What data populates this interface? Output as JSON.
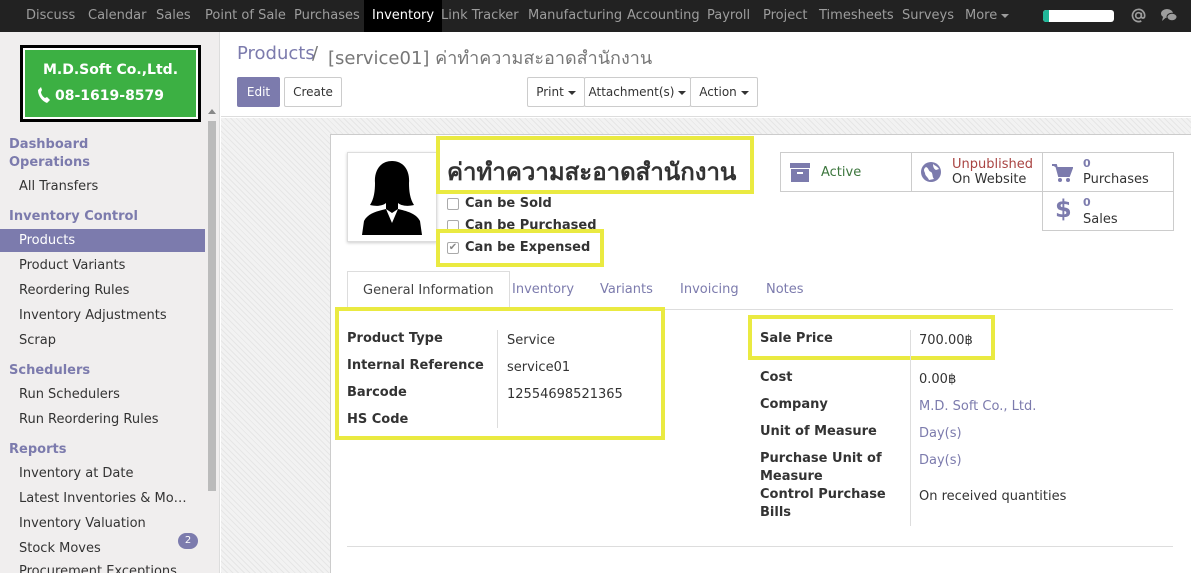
{
  "topbar": {
    "items": [
      "Discuss",
      "Calendar",
      "Sales",
      "Point of Sale",
      "Purchases",
      "Inventory",
      "Link Tracker",
      "Manufacturing",
      "Accounting",
      "Payroll",
      "Project",
      "Timesheets",
      "Surveys",
      "More"
    ],
    "active": "Inventory",
    "progress_fraction": 0.08
  },
  "logo": {
    "name": "M.D.Soft Co.,Ltd.",
    "phone": "08-1619-8579"
  },
  "sidebar": {
    "dashboard": "Dashboard",
    "operations": "Operations",
    "all_transfers": "All Transfers",
    "inventory_control": "Inventory Control",
    "products": "Products",
    "product_variants": "Product Variants",
    "reordering_rules": "Reordering Rules",
    "inventory_adjustments": "Inventory Adjustments",
    "scrap": "Scrap",
    "schedulers": "Schedulers",
    "run_schedulers": "Run Schedulers",
    "run_reordering_rules": "Run Reordering Rules",
    "reports": "Reports",
    "inventory_at_date": "Inventory at Date",
    "latest_inventories": "Latest Inventories & Mo…",
    "inventory_valuation": "Inventory Valuation",
    "stock_moves": "Stock Moves",
    "procurement_exceptions": "Procurement Exceptions",
    "procurement_badge": "2"
  },
  "breadcrumb": {
    "root": "Products",
    "sep": "/",
    "current": "[service01] ค่าทำความสะอาดสำนักงาน"
  },
  "buttons": {
    "edit": "Edit",
    "create": "Create",
    "print": "Print",
    "attachments": "Attachment(s)",
    "action": "Action"
  },
  "product": {
    "name": "ค่าทำความสะอาดสำนักงาน",
    "can_be_sold": "Can be Sold",
    "can_be_purchased": "Can be Purchased",
    "can_be_expensed": "Can be Expensed",
    "expensed_checkmark": "✔"
  },
  "smart": {
    "active": "Active",
    "unpublished": "Unpublished",
    "on_website": "On Website",
    "purchases_count": "0",
    "purchases": "Purchases",
    "sales_count": "0",
    "sales": "Sales"
  },
  "tabs": [
    "General Information",
    "Inventory",
    "Variants",
    "Invoicing",
    "Notes"
  ],
  "fields_left": [
    {
      "label": "Product Type",
      "value": "Service"
    },
    {
      "label": "Internal Reference",
      "value": "service01"
    },
    {
      "label": "Barcode",
      "value": "12554698521365"
    },
    {
      "label": "HS Code",
      "value": ""
    }
  ],
  "fields_right": {
    "sale_price_label": "Sale Price",
    "sale_price": "700.00฿",
    "cost_label": "Cost",
    "cost": "0.00฿",
    "company_label": "Company",
    "company": "M.D. Soft Co., Ltd.",
    "uom_label": "Unit of Measure",
    "uom": "Day(s)",
    "puom_label_1": "Purchase Unit of",
    "puom_label_2": "Measure",
    "puom": "Day(s)",
    "cpb_label_1": "Control Purchase",
    "cpb_label_2": "Bills",
    "cpb": "On received quantities"
  },
  "colors": {
    "brand": "#7c7bad",
    "highlight": "#eaea41",
    "logo_green": "#3cb043",
    "active_green": "#3c763d",
    "unpublished_red": "#a94442"
  }
}
